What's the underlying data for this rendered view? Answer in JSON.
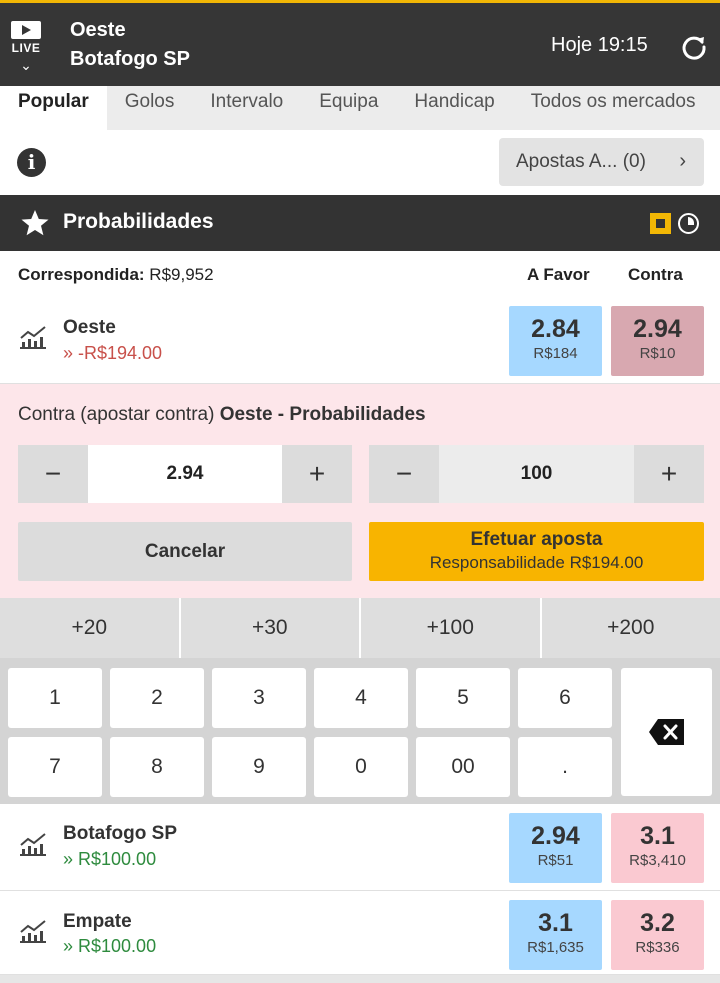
{
  "header": {
    "live_label": "LIVE",
    "team_a": "Oeste",
    "team_b": "Botafogo SP",
    "time": "Hoje 19:15",
    "accent_color": "#f2b705"
  },
  "tabs": [
    {
      "label": "Popular",
      "active": true
    },
    {
      "label": "Golos",
      "active": false
    },
    {
      "label": "Intervalo",
      "active": false
    },
    {
      "label": "Equipa",
      "active": false
    },
    {
      "label": "Handicap",
      "active": false
    },
    {
      "label": "Todos os mercados",
      "active": false
    }
  ],
  "betslip": {
    "label": "Apostas A...",
    "count": "(0)"
  },
  "section": {
    "title": "Probabilidades"
  },
  "matched": {
    "label": "Correspondida:",
    "value": "R$9,952",
    "col_back": "A Favor",
    "col_lay": "Contra"
  },
  "runners": [
    {
      "name": "Oeste",
      "pl": "» -R$194.00",
      "back_price": "2.84",
      "back_size": "R$184",
      "lay_price": "2.94",
      "lay_size": "R$10"
    },
    {
      "name": "Botafogo SP",
      "pl": "» R$100.00",
      "back_price": "2.94",
      "back_size": "R$51",
      "lay_price": "3.1",
      "lay_size": "R$3,410"
    },
    {
      "name": "Empate",
      "pl": "» R$100.00",
      "back_price": "3.1",
      "back_size": "R$1,635",
      "lay_price": "3.2",
      "lay_size": "R$336"
    }
  ],
  "bet": {
    "title_prefix": "Contra (apostar contra)",
    "title_bold": "Oeste - Probabilidades",
    "odds_value": "2.94",
    "stake_value": "100",
    "minus": "−",
    "plus": "+",
    "cancel_label": "Cancelar",
    "place_label": "Efetuar aposta",
    "liability_label": "Responsabilidade R$194.00"
  },
  "quick_stakes": [
    "+20",
    "+30",
    "+100",
    "+200"
  ],
  "keypad": [
    "1",
    "2",
    "3",
    "4",
    "5",
    "6",
    "7",
    "8",
    "9",
    "0",
    "00",
    "."
  ]
}
